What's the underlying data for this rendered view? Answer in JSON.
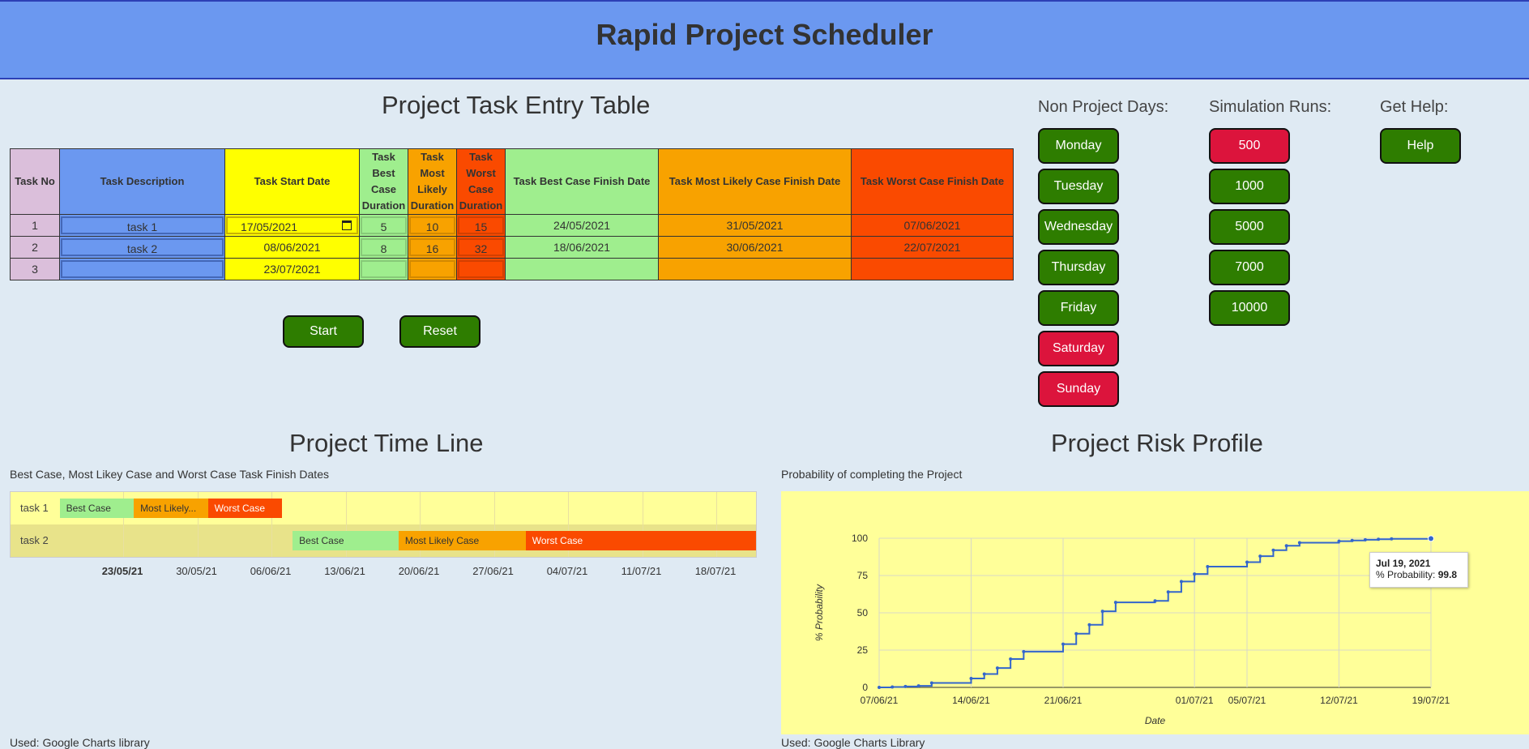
{
  "header": {
    "title": "Rapid Project Scheduler"
  },
  "task_entry": {
    "title": "Project Task Entry Table",
    "headers": {
      "no": "Task No",
      "desc": "Task Description",
      "start": "Task Start Date",
      "best_dur": [
        "Task",
        "Best",
        "Case",
        "Duration"
      ],
      "likely_dur": [
        "Task",
        "Most",
        "Likely",
        "Duration"
      ],
      "worst_dur": [
        "Task",
        "Worst",
        "Case",
        "Duration"
      ],
      "best_finish": "Task Best Case Finish Date",
      "likely_finish": "Task Most Likely Case Finish Date",
      "worst_finish": "Task Worst Case Finish Date"
    },
    "rows": [
      {
        "no": "1",
        "desc": "task 1",
        "start": "17/05/2021",
        "best": "5",
        "likely": "10",
        "worst": "15",
        "best_finish": "24/05/2021",
        "likely_finish": "31/05/2021",
        "worst_finish": "07/06/2021"
      },
      {
        "no": "2",
        "desc": "task 2",
        "start": "08/06/2021",
        "best": "8",
        "likely": "16",
        "worst": "32",
        "best_finish": "18/06/2021",
        "likely_finish": "30/06/2021",
        "worst_finish": "22/07/2021"
      },
      {
        "no": "3",
        "desc": "",
        "start": "23/07/2021",
        "best": "",
        "likely": "",
        "worst": "",
        "best_finish": "",
        "likely_finish": "",
        "worst_finish": ""
      }
    ],
    "start_button": "Start",
    "reset_button": "Reset"
  },
  "non_project_days": {
    "title": "Non Project Days:",
    "days": [
      {
        "label": "Monday",
        "state": "green"
      },
      {
        "label": "Tuesday",
        "state": "green"
      },
      {
        "label": "Wednesday",
        "state": "green"
      },
      {
        "label": "Thursday",
        "state": "green"
      },
      {
        "label": "Friday",
        "state": "green"
      },
      {
        "label": "Saturday",
        "state": "red"
      },
      {
        "label": "Sunday",
        "state": "red"
      }
    ]
  },
  "simulation_runs": {
    "title": "Simulation Runs:",
    "options": [
      {
        "label": "500",
        "state": "red"
      },
      {
        "label": "1000",
        "state": "green"
      },
      {
        "label": "5000",
        "state": "green"
      },
      {
        "label": "7000",
        "state": "green"
      },
      {
        "label": "10000",
        "state": "green"
      }
    ]
  },
  "help": {
    "title": "Get Help:",
    "button": "Help"
  },
  "timeline": {
    "title": "Project Time Line",
    "subtitle": "Best Case, Most Likey Case and Worst Case Task Finish Dates",
    "footer": "Used: Google Charts library",
    "tasks": [
      {
        "label": "task 1",
        "bars": [
          {
            "label": "Best Case",
            "kind": "best",
            "start": "2021-05-17",
            "end": "2021-05-24"
          },
          {
            "label": "Most Likely...",
            "kind": "likely",
            "start": "2021-05-24",
            "end": "2021-05-31"
          },
          {
            "label": "Worst Case",
            "kind": "worst",
            "start": "2021-05-31",
            "end": "2021-06-07"
          }
        ]
      },
      {
        "label": "task 2",
        "bars": [
          {
            "label": "Best Case",
            "kind": "best",
            "start": "2021-06-08",
            "end": "2021-06-18"
          },
          {
            "label": "Most Likely Case",
            "kind": "likely",
            "start": "2021-06-18",
            "end": "2021-06-30"
          },
          {
            "label": "Worst Case",
            "kind": "worst",
            "start": "2021-06-30",
            "end": "2021-07-22"
          }
        ]
      }
    ],
    "ticks": [
      "23/05/21",
      "30/05/21",
      "06/06/21",
      "13/06/21",
      "20/06/21",
      "27/06/21",
      "04/07/21",
      "11/07/21",
      "18/07/21"
    ],
    "bold_tick": "23/05/21"
  },
  "risk_profile": {
    "title": "Project Risk Profile",
    "subtitle": "Probability of completing the Project",
    "footer": "Used: Google Charts Library",
    "tooltip": {
      "date": "Jul 19, 2021",
      "label": "% Probability:",
      "value": "99.8"
    }
  },
  "chart_data": {
    "type": "line",
    "title": "",
    "xlabel": "Date",
    "ylabel": "% Probability",
    "ylim": [
      0,
      100
    ],
    "xlim": [
      "2021-06-07",
      "2021-07-19"
    ],
    "x_ticks": [
      "07/06/21",
      "14/06/21",
      "21/06/21",
      "01/07/21",
      "05/07/21",
      "12/07/21",
      "19/07/21"
    ],
    "y_ticks": [
      0,
      25,
      50,
      75,
      100
    ],
    "grid": true,
    "step": true,
    "series": [
      {
        "x": [
          "2021-06-07",
          "2021-06-08",
          "2021-06-09",
          "2021-06-10",
          "2021-06-11",
          "2021-06-14",
          "2021-06-15",
          "2021-06-16",
          "2021-06-17",
          "2021-06-18",
          "2021-06-21",
          "2021-06-22",
          "2021-06-23",
          "2021-06-24",
          "2021-06-25",
          "2021-06-28",
          "2021-06-29",
          "2021-06-30",
          "2021-07-01",
          "2021-07-02",
          "2021-07-05",
          "2021-07-06",
          "2021-07-07",
          "2021-07-08",
          "2021-07-09",
          "2021-07-12",
          "2021-07-13",
          "2021-07-14",
          "2021-07-15",
          "2021-07-16",
          "2021-07-19"
        ],
        "y": [
          0,
          0.3,
          0.6,
          1,
          3,
          6,
          9,
          13,
          19,
          24,
          29,
          36,
          42,
          51,
          57,
          58,
          64,
          71,
          76,
          81,
          84,
          88,
          92,
          95,
          97,
          98,
          98.5,
          99,
          99.3,
          99.6,
          99.8
        ]
      }
    ]
  }
}
